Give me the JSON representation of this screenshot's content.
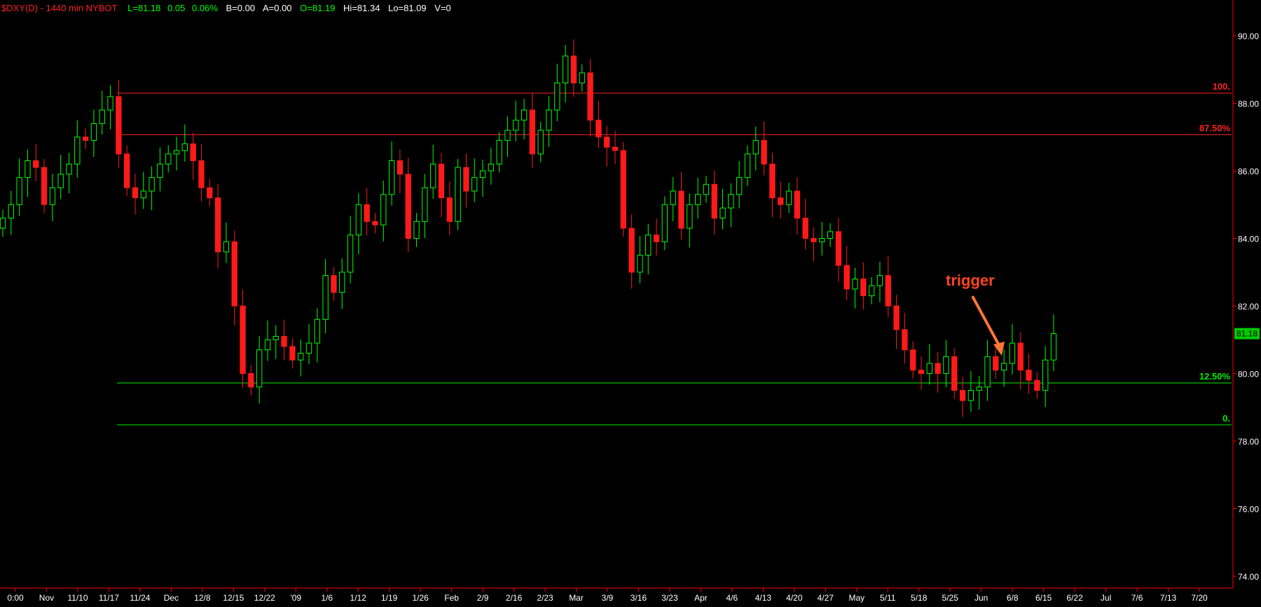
{
  "header": {
    "symbol": "$DXY(D) - 1440 min  NYBOT",
    "last": "L=81.18",
    "change": "0.05",
    "change_pct": "0.06%",
    "bid": "B=0.00",
    "ask": "A=0.00",
    "open": "O=81.19",
    "high": "Hi=81.34",
    "low": "Lo=81.09",
    "volume": "V=0"
  },
  "annotation": {
    "text": "trigger",
    "color": "#ff6633"
  },
  "colors": {
    "up": "#00ff00",
    "down": "#ff1a1a",
    "axis": "#ff0000",
    "background": "#000000",
    "fib_high": "#ff2222",
    "fib_low": "#00ee00"
  },
  "chart_data": {
    "type": "candlestick",
    "symbol": "$DXY(D)",
    "ylim": [
      73.5,
      91.0
    ],
    "yticks": [
      "90.00",
      "88.00",
      "86.00",
      "84.00",
      "82.00",
      "80.00",
      "78.00",
      "76.00",
      "74.00"
    ],
    "last_price_label": "81.18",
    "last_price": 81.18,
    "xticks": [
      "0:00",
      "Nov",
      "11/10",
      "11/17",
      "11/24",
      "Dec",
      "12/8",
      "12/15",
      "12/22",
      "'09",
      "1/6",
      "1/12",
      "1/19",
      "1/26",
      "Feb",
      "2/9",
      "2/16",
      "2/23",
      "Mar",
      "3/9",
      "3/16",
      "3/23",
      "Apr",
      "4/6",
      "4/13",
      "4/20",
      "4/27",
      "May",
      "5/11",
      "5/18",
      "5/25",
      "Jun",
      "6/8",
      "6/15",
      "6/22",
      "Jul",
      "7/6",
      "7/13",
      "7/20"
    ],
    "fib_levels": [
      {
        "label": "100.",
        "value": 88.3,
        "color": "#ff2222"
      },
      {
        "label": "87.50%",
        "value": 87.07,
        "color": "#ff2222"
      },
      {
        "label": "12.50%",
        "value": 79.72,
        "color": "#00ee00"
      },
      {
        "label": "0.",
        "value": 78.48,
        "color": "#00ee00"
      }
    ],
    "series_close": [
      84.6,
      85.0,
      85.8,
      86.3,
      86.1,
      85.0,
      85.5,
      85.9,
      86.2,
      87.0,
      86.9,
      87.4,
      87.8,
      88.2,
      86.5,
      85.5,
      85.2,
      85.4,
      85.8,
      86.2,
      86.5,
      86.6,
      86.8,
      86.3,
      85.5,
      85.2,
      83.6,
      83.9,
      82.0,
      80.0,
      79.6,
      80.7,
      81.0,
      81.1,
      80.8,
      80.4,
      80.6,
      80.9,
      81.6,
      82.9,
      82.4,
      83.0,
      84.1,
      85.0,
      84.5,
      84.4,
      85.3,
      86.3,
      85.9,
      84.0,
      84.5,
      85.5,
      86.2,
      85.2,
      84.5,
      86.1,
      85.4,
      85.8,
      86.0,
      86.2,
      86.9,
      87.2,
      87.5,
      87.8,
      86.5,
      87.2,
      87.8,
      88.6,
      89.4,
      88.6,
      88.9,
      87.5,
      87.0,
      86.7,
      86.6,
      84.3,
      83.0,
      83.5,
      84.1,
      83.9,
      85.0,
      85.4,
      84.3,
      85.0,
      85.3,
      85.6,
      84.6,
      84.9,
      85.3,
      85.8,
      86.5,
      86.9,
      86.2,
      85.2,
      85.0,
      85.4,
      84.6,
      84.0,
      83.9,
      84.0,
      84.2,
      83.2,
      82.5,
      82.8,
      82.3,
      82.6,
      82.9,
      82.0,
      81.3,
      80.7,
      80.1,
      80.0,
      80.3,
      80.0,
      80.5,
      79.5,
      79.2,
      79.5,
      79.6,
      80.5,
      80.1,
      80.3,
      80.9,
      80.1,
      79.8,
      79.5,
      80.4,
      81.18
    ]
  }
}
